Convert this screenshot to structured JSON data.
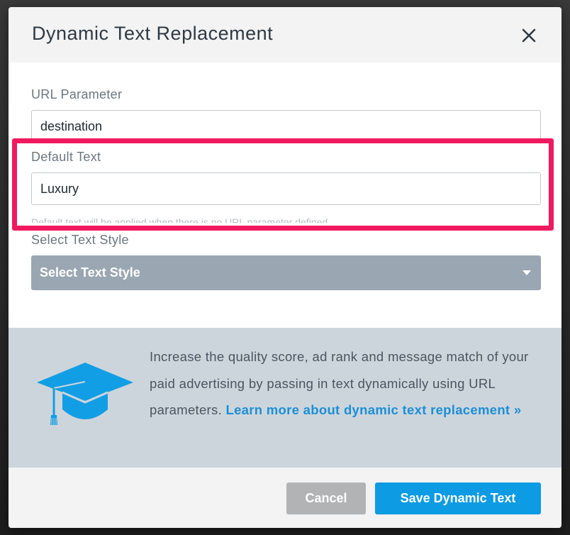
{
  "modal": {
    "title": "Dynamic Text Replacement",
    "close_icon": "close-icon"
  },
  "form": {
    "url_parameter": {
      "label": "URL Parameter",
      "value": "destination"
    },
    "default_text": {
      "label": "Default Text",
      "value": "Luxury",
      "helper": "Default text will be applied when there is no URL parameter defined"
    },
    "text_style": {
      "label": "Select Text Style",
      "selected": "Select Text Style"
    }
  },
  "info": {
    "icon": "graduation-cap-icon",
    "text": "Increase the quality score, ad rank and message match of your paid advertising by passing in text dynamically using URL parameters.",
    "link_text": "Learn more about dynamic text replacement »"
  },
  "footer": {
    "cancel_label": "Cancel",
    "save_label": "Save Dynamic Text"
  },
  "colors": {
    "highlight": "#f0195f",
    "primary": "#0d9be3",
    "link": "#1c8fd6",
    "select_bg": "#9aa6b1"
  }
}
